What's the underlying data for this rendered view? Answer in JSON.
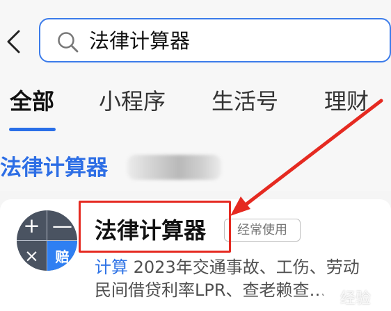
{
  "header": {
    "search_value": "法律计算器"
  },
  "tabs": [
    {
      "label": "全部"
    },
    {
      "label": "小程序"
    },
    {
      "label": "生活号"
    },
    {
      "label": "理财"
    }
  ],
  "section": {
    "title": "法律计算器"
  },
  "result": {
    "logo": {
      "top_left": "+",
      "top_right": "—",
      "bottom_left": "×",
      "bottom_right": "赔"
    },
    "name": "法律计算器",
    "tag": "经常使用",
    "description_highlight": "计算",
    "description_line_1": " 2023年交通事故、工伤、劳动",
    "description_line_2": "民间借贷利率LPR、查老赖查…"
  },
  "watermark": "经验"
}
